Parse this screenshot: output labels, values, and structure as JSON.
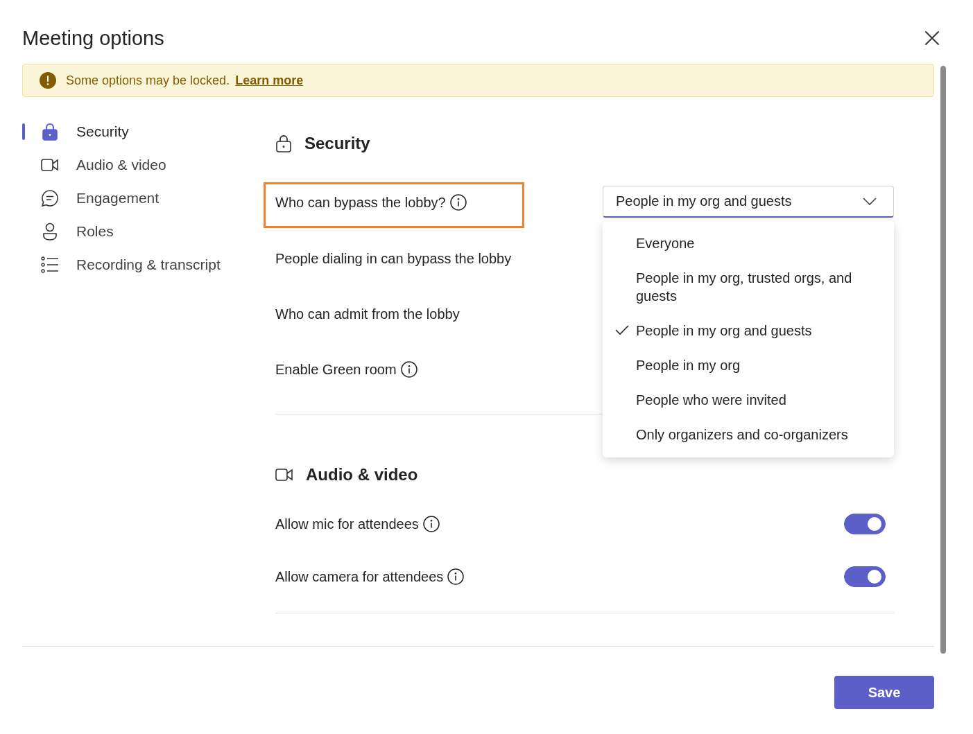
{
  "title": "Meeting options",
  "banner": {
    "message": "Some options may be locked.",
    "link": "Learn more"
  },
  "sidebar": {
    "items": [
      {
        "label": "Security",
        "selected": true
      },
      {
        "label": "Audio & video",
        "selected": false
      },
      {
        "label": "Engagement",
        "selected": false
      },
      {
        "label": "Roles",
        "selected": false
      },
      {
        "label": "Recording & transcript",
        "selected": false
      }
    ]
  },
  "sections": [
    {
      "title": "Security",
      "rows": [
        {
          "kind": "dropdown",
          "label": "Who can bypass the lobby?",
          "info": true,
          "highlighted": true,
          "value": "People in my org and guests",
          "options": [
            {
              "label": "Everyone",
              "selected": false
            },
            {
              "label": "People in my org, trusted orgs, and guests",
              "selected": false
            },
            {
              "label": "People in my org and guests",
              "selected": true
            },
            {
              "label": "People in my org",
              "selected": false
            },
            {
              "label": "People who were invited",
              "selected": false
            },
            {
              "label": "Only organizers and co-organizers",
              "selected": false
            }
          ]
        },
        {
          "kind": "plain",
          "label": "People dialing in can bypass the lobby",
          "info": false,
          "highlighted": false
        },
        {
          "kind": "plain",
          "label": "Who can admit from the lobby",
          "info": false,
          "highlighted": false
        },
        {
          "kind": "plain",
          "label": "Enable Green room",
          "info": true,
          "highlighted": false
        }
      ]
    },
    {
      "title": "Audio & video",
      "rows": [
        {
          "kind": "toggle",
          "label": "Allow mic for attendees",
          "info": true,
          "highlighted": false,
          "on": true
        },
        {
          "kind": "toggle",
          "label": "Allow camera for attendees",
          "info": true,
          "highlighted": false,
          "on": true
        }
      ]
    }
  ],
  "footer": {
    "save": "Save"
  }
}
